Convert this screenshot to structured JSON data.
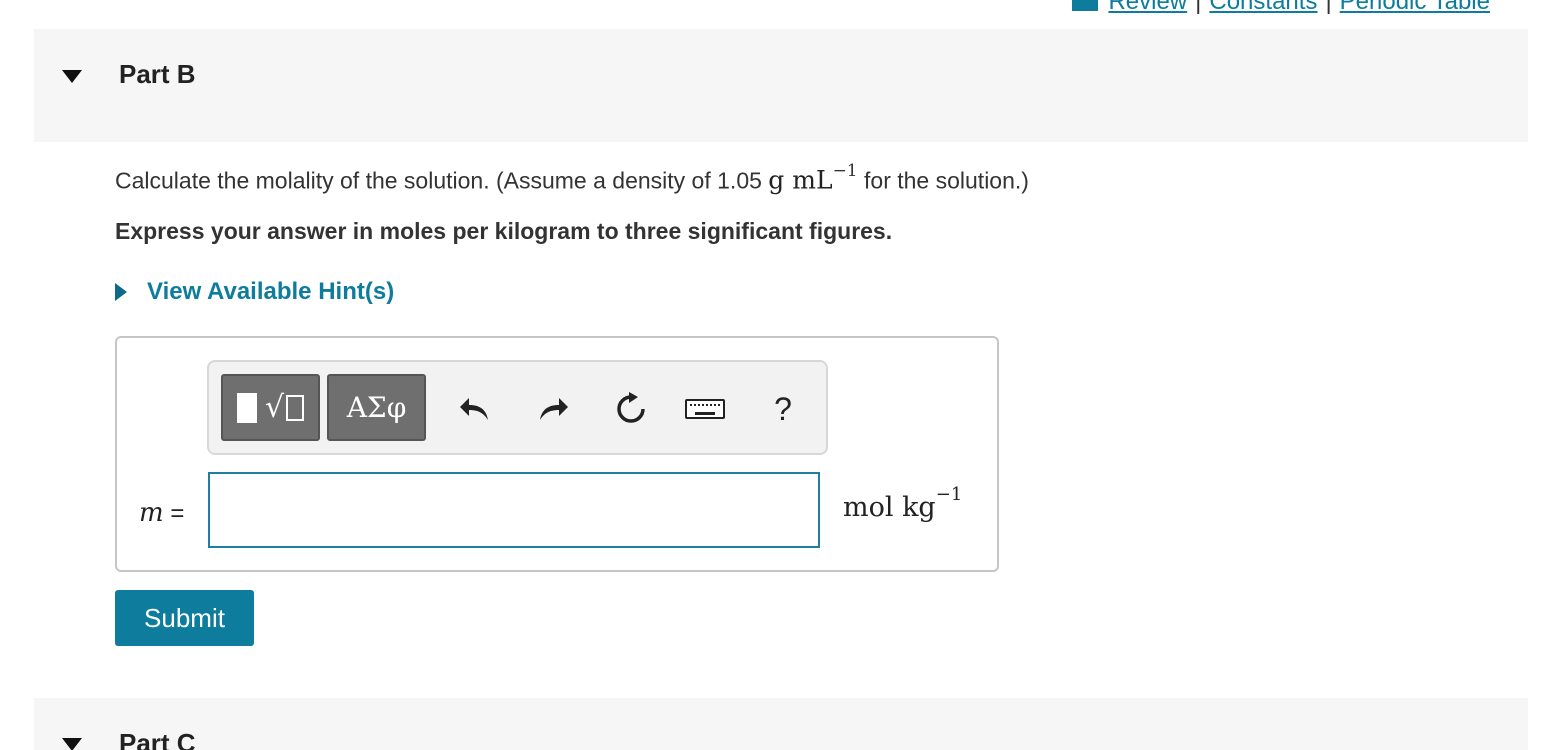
{
  "top_links": {
    "review": "Review",
    "constants": "Constants",
    "periodic_table": "Periodic Table",
    "separator": "|"
  },
  "part_b": {
    "title": "Part B",
    "question_prefix": "Calculate the molality of the solution. (Assume a density of 1.05",
    "question_unit": "g mL",
    "question_exponent": "−1",
    "question_suffix": "for the solution.)",
    "instruction": "Express your answer in moles per kilogram to three significant figures.",
    "hints_label": "View Available Hint(s)"
  },
  "toolbar": {
    "greek_label": "ΑΣφ",
    "help_label": "?"
  },
  "answer": {
    "variable": "m",
    "equals": "=",
    "value": "",
    "unit_base": "mol kg",
    "unit_exponent": "−1"
  },
  "submit_label": "Submit",
  "part_c": {
    "title": "Part C"
  },
  "colors": {
    "accent": "#0e7c9c",
    "header_bg": "#f6f6f6",
    "toolbar_button": "#6f6f6f"
  }
}
